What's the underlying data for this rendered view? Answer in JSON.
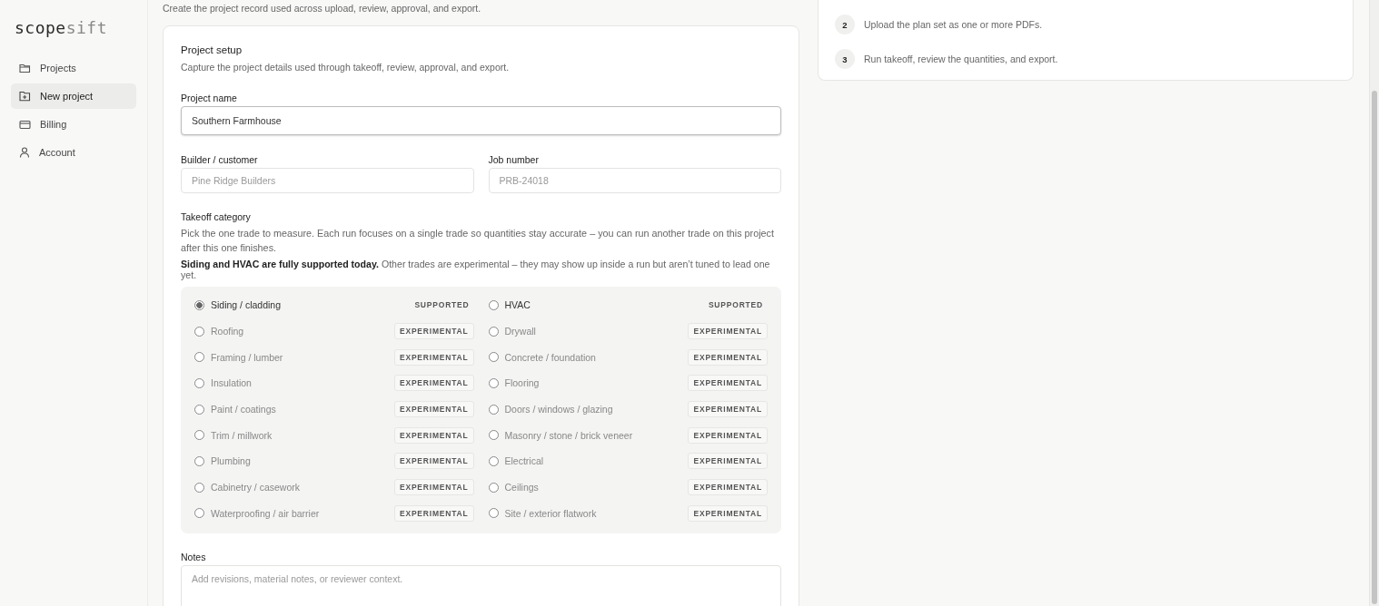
{
  "brand": {
    "parts": [
      "scope",
      "sift"
    ]
  },
  "sidebar": {
    "items": [
      {
        "label": "Projects",
        "selected": false
      },
      {
        "label": "New project",
        "selected": true
      },
      {
        "label": "Billing",
        "selected": false
      },
      {
        "label": "Account",
        "selected": false
      }
    ]
  },
  "page": {
    "subtitle": "Create the project record used across upload, review, approval, and export."
  },
  "form": {
    "title": "Project setup",
    "description": "Capture the project details used through takeoff, review, approval, and export.",
    "project_name": {
      "label": "Project name",
      "value": "Southern Farmhouse"
    },
    "builder": {
      "label": "Builder / customer",
      "placeholder": "Pine Ridge Builders"
    },
    "job_number": {
      "label": "Job number",
      "placeholder": "PRB-24018"
    },
    "category": {
      "label": "Takeoff category",
      "help": "Pick the one trade to measure. Each run focuses on a single trade so quantities stay accurate – you can run another trade on this project after this one finishes.",
      "note": "**Siding and HVAC are fully supported today.** Other trades are experimental – they may show up inside a run but aren’t tuned to lead one yet.",
      "options": [
        {
          "label": "Siding / cladding",
          "badge": "SUPPORTED",
          "kind": "supported",
          "selected": true
        },
        {
          "label": "HVAC",
          "badge": "SUPPORTED",
          "kind": "supported",
          "selected": false
        },
        {
          "label": "Roofing",
          "badge": "EXPERIMENTAL",
          "kind": "experimental",
          "selected": false
        },
        {
          "label": "Drywall",
          "badge": "EXPERIMENTAL",
          "kind": "experimental",
          "selected": false
        },
        {
          "label": "Framing / lumber",
          "badge": "EXPERIMENTAL",
          "kind": "experimental",
          "selected": false
        },
        {
          "label": "Concrete / foundation",
          "badge": "EXPERIMENTAL",
          "kind": "experimental",
          "selected": false
        },
        {
          "label": "Insulation",
          "badge": "EXPERIMENTAL",
          "kind": "experimental",
          "selected": false
        },
        {
          "label": "Flooring",
          "badge": "EXPERIMENTAL",
          "kind": "experimental",
          "selected": false
        },
        {
          "label": "Paint / coatings",
          "badge": "EXPERIMENTAL",
          "kind": "experimental",
          "selected": false
        },
        {
          "label": "Doors / windows / glazing",
          "badge": "EXPERIMENTAL",
          "kind": "experimental",
          "selected": false
        },
        {
          "label": "Trim / millwork",
          "badge": "EXPERIMENTAL",
          "kind": "experimental",
          "selected": false
        },
        {
          "label": "Masonry / stone / brick veneer",
          "badge": "EXPERIMENTAL",
          "kind": "experimental",
          "selected": false
        },
        {
          "label": "Plumbing",
          "badge": "EXPERIMENTAL",
          "kind": "experimental",
          "selected": false
        },
        {
          "label": "Electrical",
          "badge": "EXPERIMENTAL",
          "kind": "experimental",
          "selected": false
        },
        {
          "label": "Cabinetry / casework",
          "badge": "EXPERIMENTAL",
          "kind": "experimental",
          "selected": false
        },
        {
          "label": "Ceilings",
          "badge": "EXPERIMENTAL",
          "kind": "experimental",
          "selected": false
        },
        {
          "label": "Waterproofing / air barrier",
          "badge": "EXPERIMENTAL",
          "kind": "experimental",
          "selected": false
        },
        {
          "label": "Site / exterior flatwork",
          "badge": "EXPERIMENTAL",
          "kind": "experimental",
          "selected": false
        }
      ]
    },
    "notes": {
      "label": "Notes",
      "placeholder": "Add revisions, material notes, or reviewer context."
    }
  },
  "steps": [
    {
      "number": "2",
      "text": "Upload the plan set as one or more PDFs."
    },
    {
      "number": "3",
      "text": "Run takeoff, review the quantities, and export."
    }
  ]
}
